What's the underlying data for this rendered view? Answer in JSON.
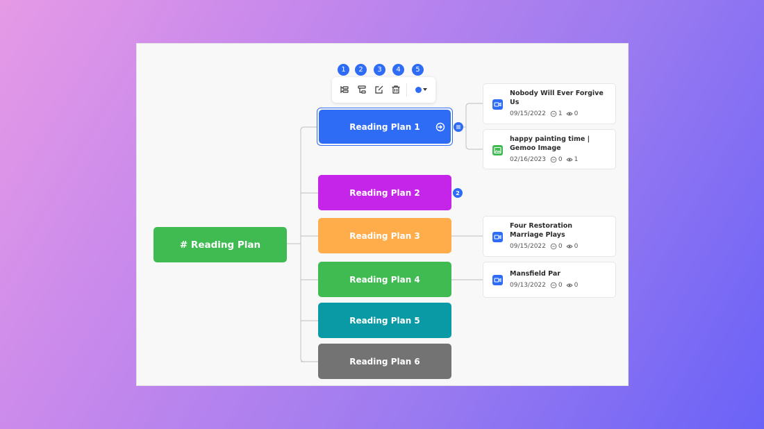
{
  "mindmap": {
    "root": {
      "label": "# Reading Plan",
      "color": "#3fbb52"
    },
    "branches": [
      {
        "label": "Reading Plan 1",
        "color": "#2f6cf6",
        "selected": true
      },
      {
        "label": "Reading Plan 2",
        "color": "#c525e8",
        "badge": "2"
      },
      {
        "label": "Reading Plan 3",
        "color": "#ffac4a"
      },
      {
        "label": "Reading Plan 4",
        "color": "#3fbb52"
      },
      {
        "label": "Reading Plan 5",
        "color": "#0a9aa5"
      },
      {
        "label": "Reading Plan 6",
        "color": "#737373"
      }
    ]
  },
  "toolbar": {
    "step_numbers": [
      "1",
      "2",
      "3",
      "4",
      "5"
    ],
    "buttons": [
      "add-child-node-icon",
      "add-sibling-node-icon",
      "edit-icon",
      "delete-icon",
      "color-picker"
    ],
    "selected_color": "#2f6cf6"
  },
  "cards": [
    {
      "title": "Nobody Will Ever Forgive Us",
      "date": "09/15/2022",
      "comments": "1",
      "views": "0",
      "icon": "video-icon",
      "icon_color": "#2f6cf6"
    },
    {
      "title": "happy painting time | Gemoo Image",
      "date": "02/16/2023",
      "comments": "0",
      "views": "1",
      "icon": "image-icon",
      "icon_color": "#3fbb52"
    },
    {
      "title": "Four Restoration Marriage Plays",
      "date": "09/15/2022",
      "comments": "0",
      "views": "0",
      "icon": "video-icon",
      "icon_color": "#2f6cf6"
    },
    {
      "title": "Mansfield Par",
      "date": "09/13/2022",
      "comments": "0",
      "views": "0",
      "icon": "video-icon",
      "icon_color": "#2f6cf6"
    }
  ]
}
